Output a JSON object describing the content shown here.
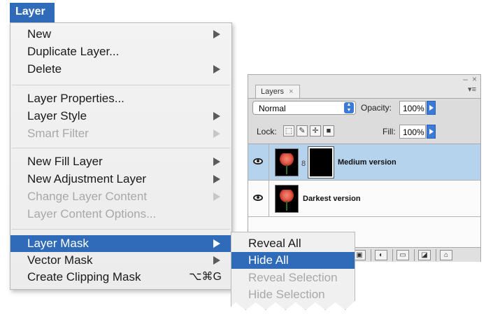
{
  "menu": {
    "title": "Layer",
    "items": [
      {
        "label": "New"
      },
      {
        "label": "Duplicate Layer..."
      },
      {
        "label": "Delete"
      },
      {
        "label": "Layer Properties..."
      },
      {
        "label": "Layer Style"
      },
      {
        "label": "Smart Filter"
      },
      {
        "label": "New Fill Layer"
      },
      {
        "label": "New Adjustment Layer"
      },
      {
        "label": "Change Layer Content"
      },
      {
        "label": "Layer Content Options..."
      },
      {
        "label": "Layer Mask"
      },
      {
        "label": "Vector Mask"
      },
      {
        "label": "Create Clipping Mask",
        "shortcut": "⌥⌘G"
      }
    ]
  },
  "submenu": {
    "items": [
      {
        "label": "Reveal All"
      },
      {
        "label": "Hide All"
      },
      {
        "label": "Reveal Selection"
      },
      {
        "label": "Hide Selection"
      }
    ]
  },
  "layers_panel": {
    "tab_label": "Layers",
    "close_glyph": "×",
    "minimize_glyph": "–",
    "panel_close_glyph": "×",
    "panel_menu_glyph": "▾≡",
    "blend_mode": "Normal",
    "opacity_label": "Opacity:",
    "opacity_value": "100%",
    "lock_label": "Lock:",
    "fill_label": "Fill:",
    "fill_value": "100%",
    "link_glyph": "8",
    "layers": [
      {
        "name": "Medium version",
        "selected": true,
        "has_mask": true
      },
      {
        "name": "Darkest version",
        "selected": false,
        "has_mask": false
      }
    ],
    "accent_color": "#2f6bb8",
    "selection_color": "#b6d3ee"
  }
}
